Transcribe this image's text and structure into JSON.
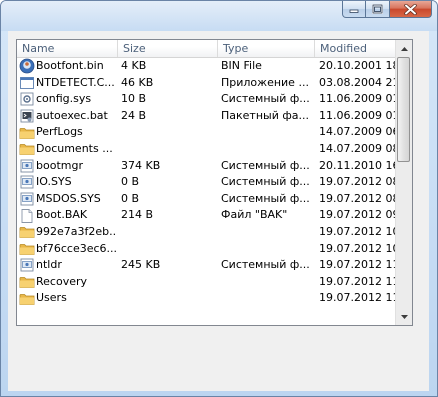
{
  "window": {
    "caption_icons": [
      "minimize-icon",
      "maximize-icon",
      "close-icon"
    ]
  },
  "scrollbar": {
    "position": 0.0,
    "visible_fraction": 0.42
  },
  "list": {
    "columns": [
      "Name",
      "Size",
      "Type",
      "Modified"
    ],
    "rows": [
      {
        "icon": "font-file-icon",
        "name": "Bootfont.bin",
        "size": "4 KB",
        "type": "BIN File",
        "modified": "20.10.2001 18:0"
      },
      {
        "icon": "app-file-icon",
        "name": "NTDETECT.C...",
        "size": "46 KB",
        "type": "Приложение ...",
        "modified": "03.08.2004 21:"
      },
      {
        "icon": "config-file-icon",
        "name": "config.sys",
        "size": "10 B",
        "type": "Системный ф...",
        "modified": "11.06.2009 01:"
      },
      {
        "icon": "batch-file-icon",
        "name": "autoexec.bat",
        "size": "24 B",
        "type": "Пакетный фа...",
        "modified": "11.06.2009 01:"
      },
      {
        "icon": "folder-icon",
        "name": "PerfLogs",
        "size": "",
        "type": "",
        "modified": "14.07.2009 06:"
      },
      {
        "icon": "folder-icon",
        "name": "Documents ...",
        "size": "",
        "type": "",
        "modified": "14.07.2009 08:"
      },
      {
        "icon": "system-file-icon",
        "name": "bootmgr",
        "size": "374 KB",
        "type": "Системный ф...",
        "modified": "20.11.2010 16:"
      },
      {
        "icon": "system-file-icon",
        "name": "IO.SYS",
        "size": "0 B",
        "type": "Системный ф...",
        "modified": "19.07.2012 08:"
      },
      {
        "icon": "system-file-icon",
        "name": "MSDOS.SYS",
        "size": "0 B",
        "type": "Системный ф...",
        "modified": "19.07.2012 08:"
      },
      {
        "icon": "blank-file-icon",
        "name": "Boot.BAK",
        "size": "214 B",
        "type": "Файл \"BAK\"",
        "modified": "19.07.2012 09:"
      },
      {
        "icon": "folder-icon",
        "name": "992e7a3f2eb...",
        "size": "",
        "type": "",
        "modified": "19.07.2012 10:"
      },
      {
        "icon": "folder-icon",
        "name": "bf76cce3ec6...",
        "size": "",
        "type": "",
        "modified": "19.07.2012 10:"
      },
      {
        "icon": "system-file-icon",
        "name": "ntldr",
        "size": "245 KB",
        "type": "Системный ф...",
        "modified": "19.07.2012 11:"
      },
      {
        "icon": "folder-icon",
        "name": "Recovery",
        "size": "",
        "type": "",
        "modified": "19.07.2012 11:"
      },
      {
        "icon": "folder-icon",
        "name": "Users",
        "size": "",
        "type": "",
        "modified": "19.07.2012 11:"
      }
    ]
  }
}
